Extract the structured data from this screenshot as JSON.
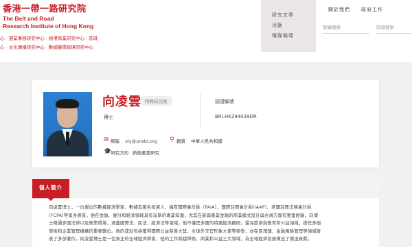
{
  "header": {
    "logo_cn": "香港一帶一路研究院",
    "logo_en_line1": "The Belt and Road",
    "logo_en_line2": "Research Institute of Hong Kong",
    "centers_row1": "心 · 選業事務研究中心 · 絕港商業研究中心 · 區域",
    "centers_row2": "心 · 文化傳播研究中心 · 數據醫學跨境研究中心",
    "nav": [
      "研究文章",
      "活動",
      "傳媒報導"
    ],
    "about_link": "關於我們",
    "policy_link": "政府工作",
    "search_placeholder": "智庫搜索",
    "search2_placeholder": "區域搜索"
  },
  "profile": {
    "name": "向凌雲",
    "tag": "特聘研究員",
    "degree": "博士",
    "right_label": "認證編號",
    "right_value": "BRI.HK294039DR",
    "email_label": "郵箱",
    "email_value": "xly@unsto.org",
    "origin_label": "籍貫",
    "origin_value": "中華人民共和國",
    "research_label": "研究方向",
    "research_value": "新興產業研究"
  },
  "intro": {
    "tab_label": "個人簡介",
    "lines": [
      "向凌雲博士，一位傑出的數據經濟學家、數據及著名投資人，擁有國際會計師（FAIA）、國際註冊會計師(IAAP)、美國註冊法務會計師",
      "(FCPA)等眾多資質。他在金融、會計和經濟領域具有深厚的專業知識，尤其在新興產業金融的商業模式設計與合規方面有豐富經驗。向博",
      "士精通多國法律以及政策環境，涵蓋國際法、民法、經濟法等領域。他不僅是多國的特邀經濟顧問，還深度參與教育和公益領域，擔任多個",
      "學術和企業管理機構的重要職位。他的成就包括獲得國際公益慈善大獎、全球外交官形象大使等榮譽，並在區塊鏈、金融風險管理等領域發",
      "表了多部著作。向凌雲博士是一位真正的全球經濟學家，他的工作跨越學術、商業和公益三大領域，為全球經濟發展做出了傑出貢獻。"
    ]
  }
}
